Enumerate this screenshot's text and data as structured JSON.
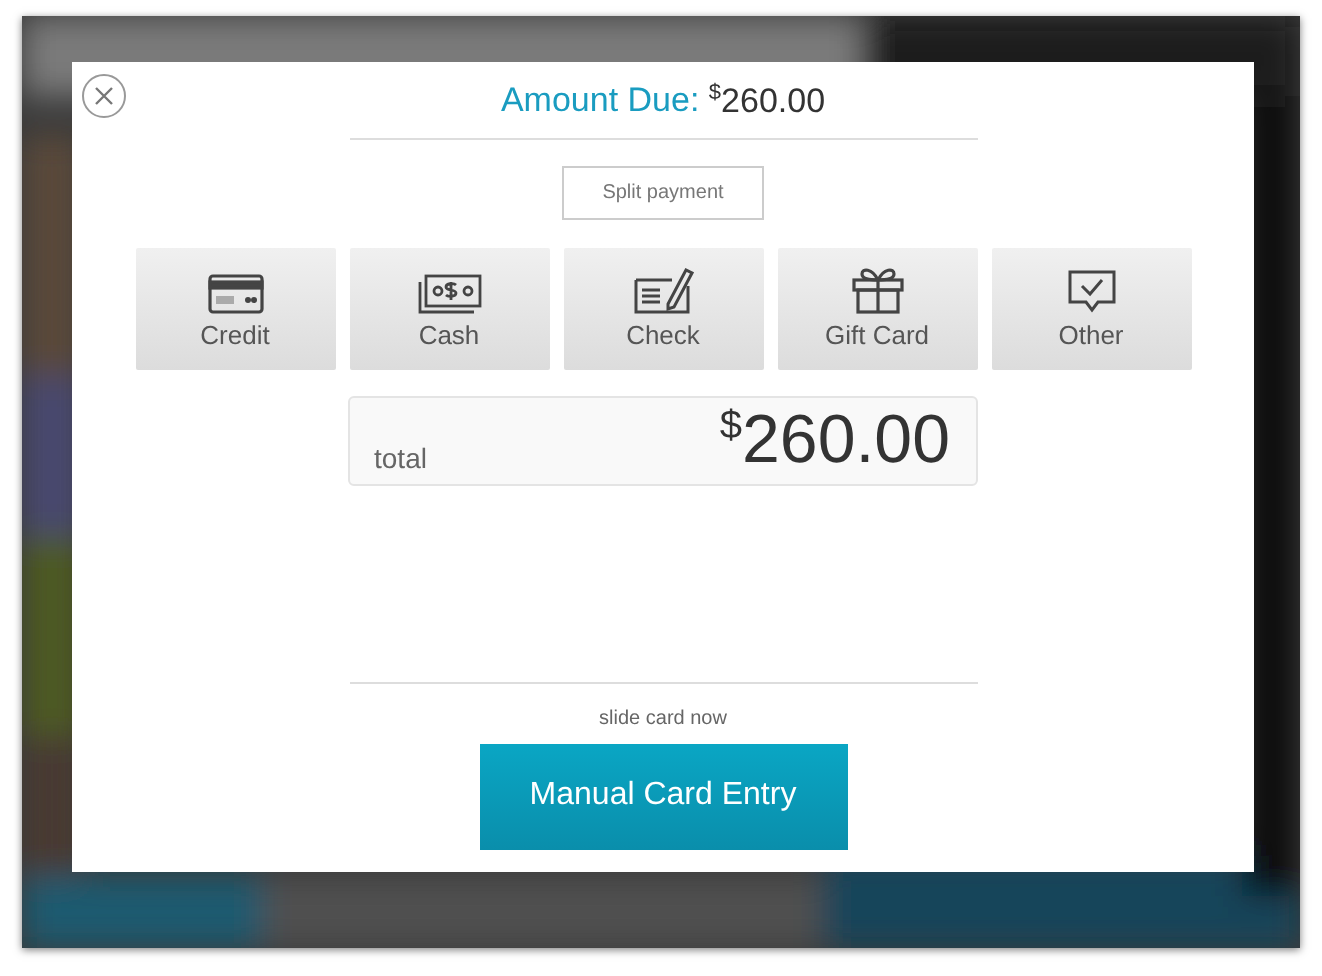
{
  "dialog": {
    "title_label": "Amount Due:",
    "title_currency": "$",
    "title_amount": "260.00",
    "split_button": "Split payment",
    "methods": [
      {
        "kind": "credit",
        "label": "Credit"
      },
      {
        "kind": "cash",
        "label": "Cash"
      },
      {
        "kind": "check",
        "label": "Check"
      },
      {
        "kind": "gift",
        "label": "Gift Card"
      },
      {
        "kind": "other",
        "label": "Other"
      }
    ],
    "total": {
      "label": "total",
      "currency": "$",
      "amount": "260.00"
    },
    "hint": "slide card now",
    "manual_button": "Manual Card Entry"
  }
}
